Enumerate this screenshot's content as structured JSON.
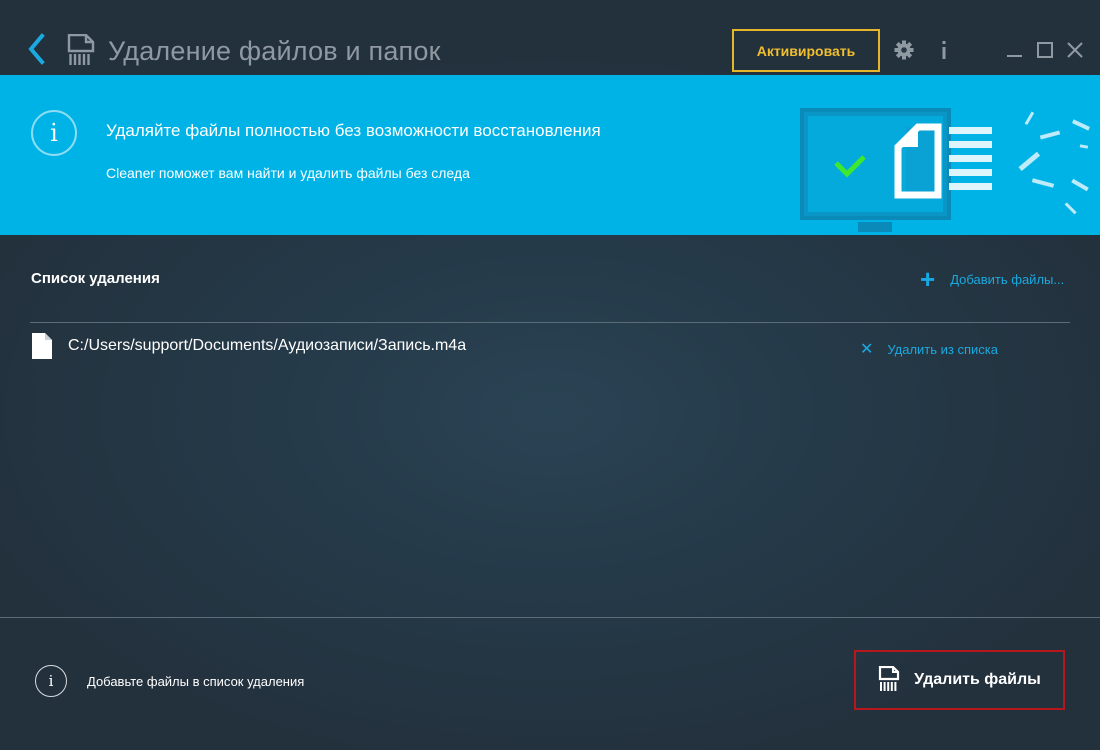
{
  "window": {
    "title": "Удаление файлов и папок",
    "activate_label": "Активировать",
    "controls": [
      "settings-icon",
      "info-icon",
      "minimize-icon",
      "maximize-icon",
      "close-icon"
    ]
  },
  "banner": {
    "heading": "Удаляйте файлы полностью без возможности восстановления",
    "subtitle": "Cleaner поможет вам найти и удалить файлы без следа",
    "info_glyph": "i"
  },
  "list": {
    "title": "Список удаления",
    "add_label": "Добавить файлы...",
    "add_icon": "plus-icon",
    "items": [
      {
        "path": "C:/Users/support/Documents/Аудиозаписи/Запись.m4a",
        "remove_label": "Удалить из списка"
      }
    ]
  },
  "footer": {
    "hint": "Добавьте файлы в список удаления",
    "info_glyph": "i",
    "delete_label": "Удалить файлы"
  },
  "colors": {
    "accent": "#00b3e6",
    "link": "#1aa9e0",
    "activate_border": "#e5b52a",
    "delete_border": "#b5171c",
    "background": "#23313d"
  }
}
